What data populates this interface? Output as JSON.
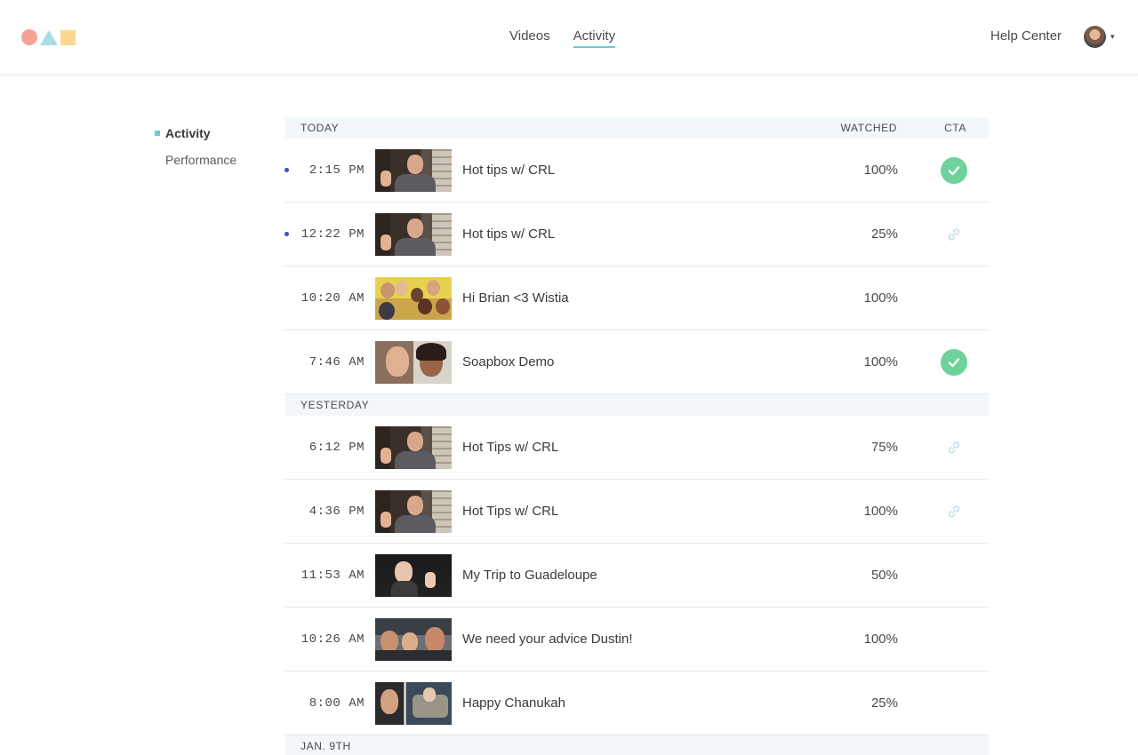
{
  "brand": {
    "colors": {
      "circle": "#f5a296",
      "triangle": "#a9dde4",
      "square": "#fbd78f",
      "accent": "#6ec9d6",
      "check": "#6fd19c",
      "unread_dot": "#3a4fc0"
    }
  },
  "nav": {
    "items": [
      {
        "label": "Videos"
      },
      {
        "label": "Activity"
      }
    ],
    "active": "Activity"
  },
  "header": {
    "help_label": "Help Center",
    "avatar_caret": "▾"
  },
  "sidebar": {
    "items": [
      {
        "label": "Activity"
      },
      {
        "label": "Performance"
      }
    ],
    "active": "Activity"
  },
  "table": {
    "columns": {
      "watched": "WATCHED",
      "cta": "CTA"
    },
    "groups": [
      {
        "label": "TODAY",
        "rows": [
          {
            "time": "2:15 PM",
            "title": "Hot tips w/ CRL",
            "watched": "100%",
            "cta": "check-icon",
            "unread": true,
            "thumb": "crl"
          },
          {
            "time": "12:22 PM",
            "title": "Hot tips w/ CRL",
            "watched": "25%",
            "cta": "link-icon",
            "unread": true,
            "thumb": "crl"
          },
          {
            "time": "10:20 AM",
            "title": "Hi Brian <3 Wistia",
            "watched": "100%",
            "cta": "",
            "unread": false,
            "thumb": "group"
          },
          {
            "time": "7:46 AM",
            "title": "Soapbox Demo",
            "watched": "100%",
            "cta": "check-icon",
            "unread": false,
            "thumb": "soap"
          }
        ]
      },
      {
        "label": "YESTERDAY",
        "rows": [
          {
            "time": "6:12 PM",
            "title": "Hot Tips w/ CRL",
            "watched": "75%",
            "cta": "link-icon",
            "unread": false,
            "thumb": "crl"
          },
          {
            "time": "4:36 PM",
            "title": "Hot Tips w/ CRL",
            "watched": "100%",
            "cta": "link-icon",
            "unread": false,
            "thumb": "crl"
          },
          {
            "time": "11:53 AM",
            "title": "My Trip to Guadeloupe",
            "watched": "50%",
            "cta": "",
            "unread": false,
            "thumb": "trip"
          },
          {
            "time": "10:26 AM",
            "title": "We need your advice Dustin!",
            "watched": "100%",
            "cta": "",
            "unread": false,
            "thumb": "advice"
          },
          {
            "time": "8:00 AM",
            "title": "Happy Chanukah",
            "watched": "25%",
            "cta": "",
            "unread": false,
            "thumb": "chan"
          }
        ]
      },
      {
        "label": "JAN. 9TH",
        "rows": []
      }
    ]
  }
}
